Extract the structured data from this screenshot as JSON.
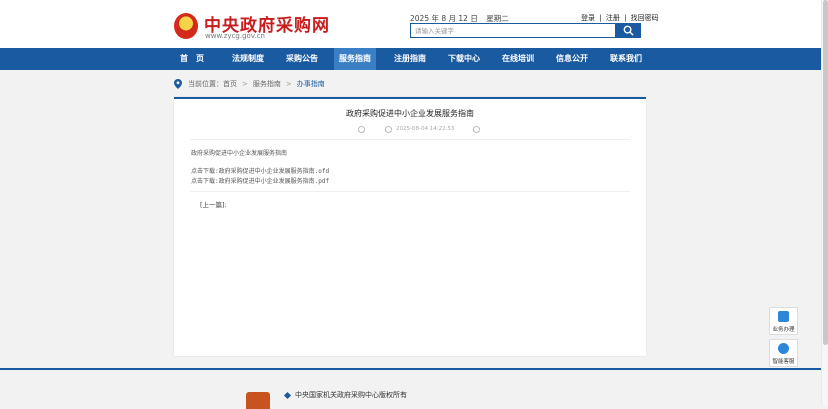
{
  "header": {
    "site_title": "中央政府采购网",
    "site_url": "www.zycg.gov.cn",
    "date": "2025 年 8 月 12 日",
    "weekday": "星期二",
    "links": [
      "登录",
      "注册",
      "找回密码"
    ],
    "separator": "|",
    "search_placeholder": "请输入关键字"
  },
  "nav": {
    "items": [
      "首　页",
      "法规制度",
      "采购公告",
      "服务指南",
      "注册指南",
      "下载中心",
      "在线培训",
      "信息公开",
      "联系我们"
    ],
    "active": "服务指南"
  },
  "breadcrumb": {
    "prefix": "当前位置：首页",
    "items": [
      "服务指南",
      "办事指南"
    ],
    "separator": ">"
  },
  "article": {
    "title": "政府采购促进中小企业发展服务指南",
    "timestamp": "2025-08-04 14:22:53",
    "body_heading": "政府采购促进中小企业发展服务指南",
    "downloads": [
      "点击下载:政府采购促进中小企业发展服务指南.ofd",
      "点击下载:政府采购促进中小企业发展服务指南.pdf"
    ],
    "prev_label": "[上一篇]:"
  },
  "side_widgets": [
    {
      "label": "业务办理",
      "icon": "phone-app-icon"
    },
    {
      "label": "智能客服",
      "icon": "chat-bot-icon"
    }
  ],
  "footer": {
    "copyright": "中央国家机关政府采购中心版权所有"
  },
  "colors": {
    "brand_blue": "#1a5aa0",
    "title_red": "#c81d1d",
    "active_nav": "#3a7fc5"
  }
}
